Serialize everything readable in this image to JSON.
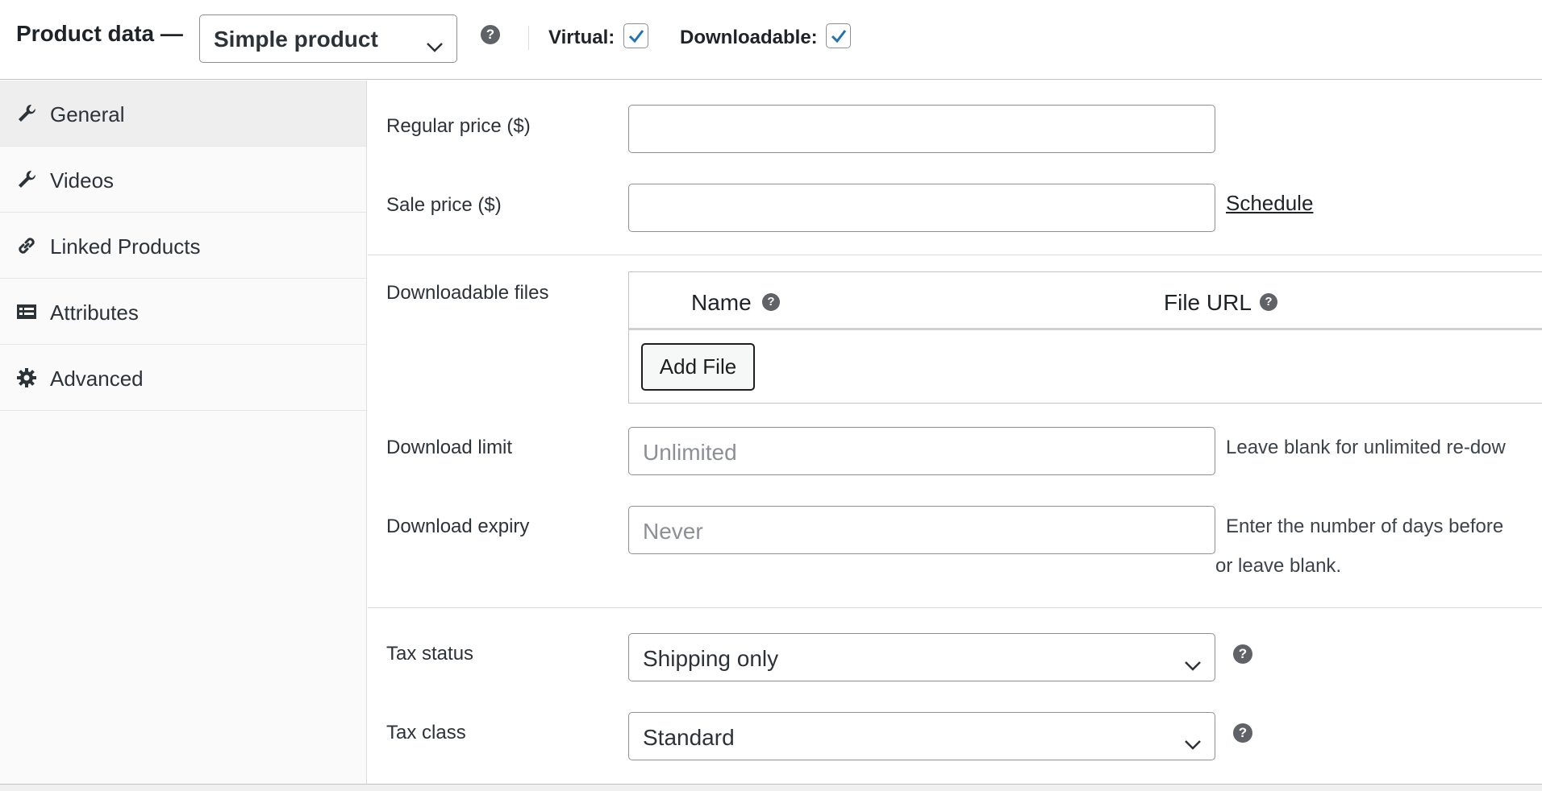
{
  "header": {
    "title": "Product data —",
    "product_type": "Simple product",
    "virtual_label": "Virtual:",
    "virtual_checked": true,
    "downloadable_label": "Downloadable:",
    "downloadable_checked": true,
    "help_glyph": "?"
  },
  "sidebar": {
    "tabs": [
      {
        "label": "General",
        "icon": "wrench-icon",
        "active": true
      },
      {
        "label": "Videos",
        "icon": "wrench-icon",
        "active": false
      },
      {
        "label": "Linked Products",
        "icon": "link-icon",
        "active": false
      },
      {
        "label": "Attributes",
        "icon": "list-view-icon",
        "active": false
      },
      {
        "label": "Advanced",
        "icon": "gear-icon",
        "active": false
      }
    ]
  },
  "general": {
    "regular_price": {
      "label": "Regular price ($)",
      "value": ""
    },
    "sale_price": {
      "label": "Sale price ($)",
      "value": ""
    },
    "schedule_link": "Schedule",
    "downloadable_files": {
      "label": "Downloadable files",
      "col_name": "Name",
      "col_url": "File URL",
      "add_button": "Add File"
    },
    "download_limit": {
      "label": "Download limit",
      "placeholder": "Unlimited",
      "description": "Leave blank for unlimited re-dow"
    },
    "download_expiry": {
      "label": "Download expiry",
      "placeholder": "Never",
      "description_line1": "Enter the number of days before",
      "description_line2": "or leave blank."
    },
    "tax_status": {
      "label": "Tax status",
      "value": "Shipping only"
    },
    "tax_class": {
      "label": "Tax class",
      "value": "Standard"
    }
  },
  "colors": {
    "accent_check": "#2271b1",
    "border": "#8c8f94",
    "sidebar_bg": "#fafafa",
    "active_tab_bg": "#eeeeee"
  }
}
